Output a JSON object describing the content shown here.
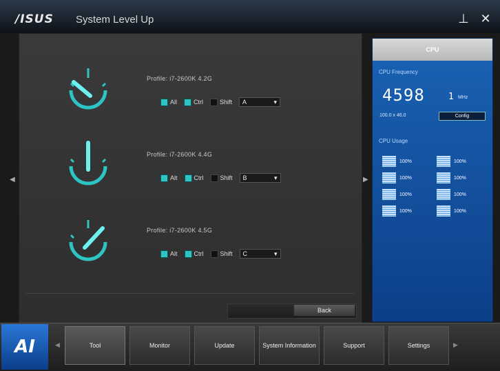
{
  "app": {
    "logo": "/ISUS",
    "title": "System Level Up",
    "pin_glyph": "⊥",
    "close_glyph": "✕"
  },
  "profiles": [
    {
      "label": "Profile: i7-2600K 4.2G",
      "opts": [
        "All",
        "Ctrl",
        "Shift"
      ],
      "checked": [
        true,
        true,
        false
      ],
      "select": "A"
    },
    {
      "label": "Profile: i7-2600K 4.4G",
      "opts": [
        "Alt",
        "Ctrl",
        "Shift"
      ],
      "checked": [
        true,
        true,
        false
      ],
      "select": "B"
    },
    {
      "label": "Profile: i7-2600K 4.5G",
      "opts": [
        "Alt",
        "Ctrl",
        "Shift"
      ],
      "checked": [
        true,
        true,
        false
      ],
      "select": "C"
    }
  ],
  "footer": {
    "back_label": "Back"
  },
  "panel": {
    "heading": "CPU",
    "freq_label": "CPU Frequency",
    "freq_value": "4598",
    "freq_sub": "1",
    "freq_unit": "MHz",
    "ratio": "100.0 x 46.0",
    "cfg_btn": "Config",
    "usage_label": "CPU Usage",
    "usage": [
      "100%",
      "100%",
      "100%",
      "100%",
      "100%",
      "100%",
      "100%",
      "100%"
    ]
  },
  "nav": [
    "Tool",
    "Monitor",
    "Update",
    "System Information",
    "Support",
    "Settings"
  ],
  "ai_logo": "AI",
  "colors": {
    "accent": "#2ec4c4",
    "panel_blue": "#1a63b5"
  }
}
